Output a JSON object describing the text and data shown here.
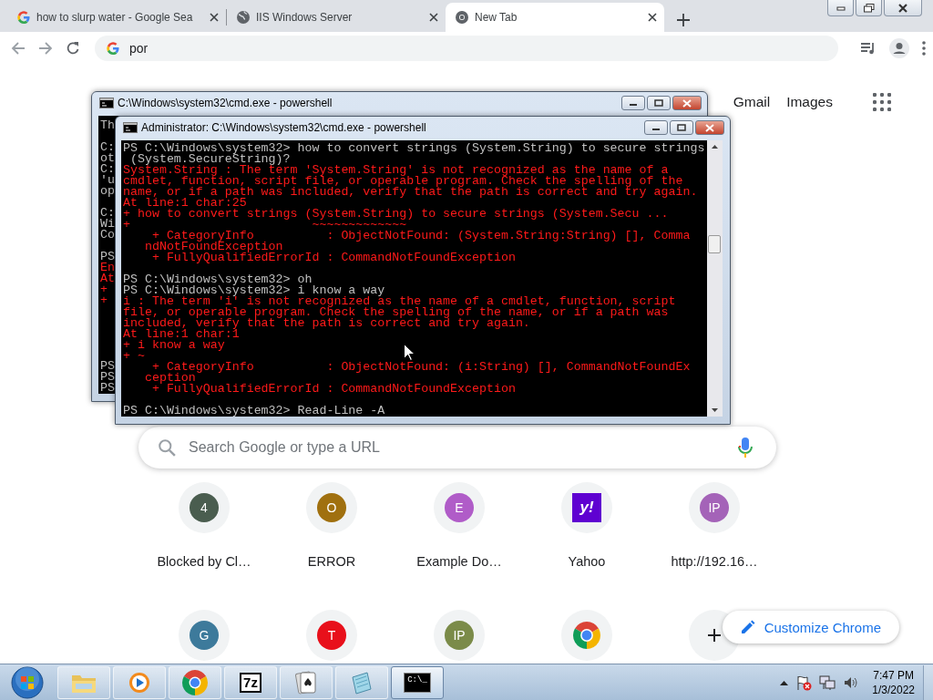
{
  "browser": {
    "tabs": [
      {
        "title": "how to slurp water - Google Sea",
        "kind": "google",
        "selected": false
      },
      {
        "title": "IIS Windows Server",
        "kind": "globe",
        "selected": false
      },
      {
        "title": "New Tab",
        "kind": "chrome",
        "selected": true
      }
    ],
    "address": {
      "value": "por"
    },
    "header_links": [
      "Gmail",
      "Images"
    ],
    "search": {
      "placeholder": "Search Google or type a URL"
    },
    "shortcuts": [
      {
        "kind": "circle",
        "letter": "4",
        "color": "#4a5d4f",
        "title": "Blocked by Cl…"
      },
      {
        "kind": "circle",
        "letter": "O",
        "color": "#a0700f",
        "title": "ERROR"
      },
      {
        "kind": "circle",
        "letter": "E",
        "color": "#b05cc8",
        "title": "Example Do…"
      },
      {
        "kind": "square",
        "letter": "y!",
        "color": "#5f01d1",
        "title": "Yahoo"
      },
      {
        "kind": "circle",
        "letter": "IP",
        "color": "#a463b8",
        "title": "http://192.16…"
      },
      {
        "kind": "circle",
        "letter": "G",
        "color": "#3d7a9b"
      },
      {
        "kind": "circle",
        "letter": "T",
        "color": "#e8101b"
      },
      {
        "kind": "circle",
        "letter": "IP",
        "color": "#7b8b49"
      },
      {
        "kind": "chrome"
      },
      {
        "kind": "add"
      }
    ],
    "customize_button": "Customize Chrome"
  },
  "console_windows": [
    {
      "title": "C:\\Windows\\system32\\cmd.exe - powershell",
      "lines": [
        {
          "kind": "output",
          "text": "Th"
        },
        {
          "kind": "blank"
        },
        {
          "kind": "output",
          "text": "C:"
        },
        {
          "kind": "output",
          "text": "ot"
        },
        {
          "kind": "output",
          "text": "C:"
        },
        {
          "kind": "output",
          "text": "'u"
        },
        {
          "kind": "output",
          "text": "op"
        },
        {
          "kind": "blank"
        },
        {
          "kind": "output",
          "text": "C:"
        },
        {
          "kind": "output",
          "text": "Wi"
        },
        {
          "kind": "output",
          "text": "Co"
        },
        {
          "kind": "blank"
        },
        {
          "kind": "output",
          "text": "PS"
        },
        {
          "kind": "error",
          "text": "En"
        },
        {
          "kind": "error",
          "text": "At"
        },
        {
          "kind": "error",
          "text": "+"
        },
        {
          "kind": "error",
          "text": "+"
        },
        {
          "kind": "blank"
        },
        {
          "kind": "blank"
        },
        {
          "kind": "blank"
        },
        {
          "kind": "blank"
        },
        {
          "kind": "blank"
        },
        {
          "kind": "output",
          "text": "PS"
        },
        {
          "kind": "output",
          "text": "PS"
        },
        {
          "kind": "output",
          "text": "PS"
        }
      ]
    },
    {
      "title": "Administrator: C:\\Windows\\system32\\cmd.exe - powershell",
      "lines": [
        {
          "kind": "output",
          "text": "PS C:\\Windows\\system32> how to convert strings (System.String) to secure strings"
        },
        {
          "kind": "output",
          "text": " (System.SecureString)?"
        },
        {
          "kind": "error",
          "text": "System.String : The term 'System.String' is not recognized as the name of a"
        },
        {
          "kind": "error",
          "text": "cmdlet, function, script file, or operable program. Check the spelling of the"
        },
        {
          "kind": "error",
          "text": "name, or if a path was included, verify that the path is correct and try again."
        },
        {
          "kind": "error",
          "text": "At line:1 char:25"
        },
        {
          "kind": "error",
          "text": "+ how to convert strings (System.String) to secure strings (System.Secu ..."
        },
        {
          "kind": "error",
          "text": "+                         ~~~~~~~~~~~~~"
        },
        {
          "kind": "error",
          "text": "    + CategoryInfo          : ObjectNotFound: (System.String:String) [], Comma"
        },
        {
          "kind": "error",
          "text": "   ndNotFoundException"
        },
        {
          "kind": "error",
          "text": "    + FullyQualifiedErrorId : CommandNotFoundException"
        },
        {
          "kind": "blank"
        },
        {
          "kind": "output",
          "text": "PS C:\\Windows\\system32> oh"
        },
        {
          "kind": "output",
          "text": "PS C:\\Windows\\system32> i know a way"
        },
        {
          "kind": "error",
          "text": "i : The term 'i' is not recognized as the name of a cmdlet, function, script"
        },
        {
          "kind": "error",
          "text": "file, or operable program. Check the spelling of the name, or if a path was"
        },
        {
          "kind": "error",
          "text": "included, verify that the path is correct and try again."
        },
        {
          "kind": "error",
          "text": "At line:1 char:1"
        },
        {
          "kind": "error",
          "text": "+ i know a way"
        },
        {
          "kind": "error",
          "text": "+ ~"
        },
        {
          "kind": "error",
          "text": "    + CategoryInfo          : ObjectNotFound: (i:String) [], CommandNotFoundEx"
        },
        {
          "kind": "error",
          "text": "   ception"
        },
        {
          "kind": "error",
          "text": "    + FullyQualifiedErrorId : CommandNotFoundException"
        },
        {
          "kind": "blank"
        },
        {
          "kind": "output",
          "text": "PS C:\\Windows\\system32> Read-Line -A"
        }
      ]
    }
  ],
  "taskbar": {
    "apps": [
      {
        "kind": "explorer",
        "selected": false
      },
      {
        "kind": "media",
        "selected": false
      },
      {
        "kind": "chrome",
        "selected": false
      },
      {
        "kind": "archiver",
        "label": "7z",
        "selected": false
      },
      {
        "kind": "cards",
        "selected": false
      },
      {
        "kind": "notepad",
        "selected": false
      },
      {
        "kind": "terminal",
        "label": "C:\\_",
        "selected": true
      }
    ],
    "clock": {
      "time": "7:47 PM",
      "date": "1/3/2022"
    }
  }
}
